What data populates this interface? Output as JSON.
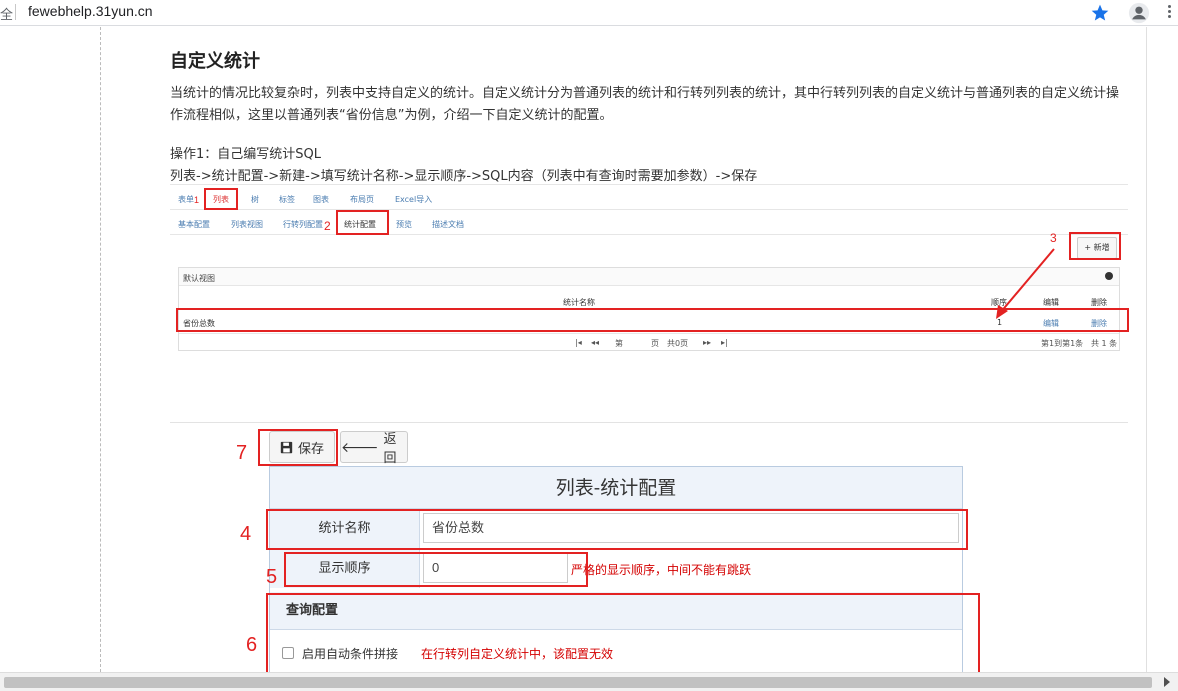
{
  "browser": {
    "secure_label": "全",
    "url": "fewebhelp.31yun.cn"
  },
  "doc": {
    "title": "自定义统计",
    "paragraph": "当统计的情况比较复杂时，列表中支持自定义的统计。自定义统计分为普通列表的统计和行转列列表的统计，其中行转列列表的自定义统计与普通列表的自定义统计操作流程相似，这里以普通列表“省份信息”为例，介绍一下自定义统计的配置。",
    "step1": "操作1：自己编写统计SQL",
    "step2": "列表->统计配置->新建->填写统计名称->显示顺序->SQL内容（列表中有查询时需要加参数）->保存"
  },
  "shot1": {
    "top_tabs": [
      "表单",
      "列表",
      "树",
      "标签",
      "图表",
      "布局页",
      "Excel导入"
    ],
    "sub_tabs": [
      "基本配置",
      "列表视图",
      "行转列配置",
      "统计配置",
      "预览",
      "描述文档"
    ],
    "add_button": "+ 新增",
    "panel_title": "默认视图",
    "columns": [
      "统计名称",
      "顺序",
      "编辑",
      "删除"
    ],
    "row": {
      "name": "省份总数",
      "order": "1",
      "edit": "编辑",
      "delete": "删除"
    },
    "pager": {
      "page_prefix": "第",
      "page_suffix": "页",
      "total_pages": "共0页",
      "range": "第1到第1条",
      "total": "共 1 条"
    },
    "annotations": [
      "1",
      "2",
      "3"
    ]
  },
  "shot2": {
    "save_label": "保存",
    "back_label": "返回",
    "form_title": "列表-统计配置",
    "name_label": "统计名称",
    "name_value": "省份总数",
    "order_label": "显示顺序",
    "order_value": "0",
    "order_hint": "严格的显示顺序，中间不能有跳跃",
    "query_title": "查询配置",
    "auto_cond_label": "启用自动条件拼接",
    "auto_cond_hint": "在行转列自定义统计中，该配置无效",
    "annotations": [
      "4",
      "5",
      "6",
      "7"
    ]
  },
  "colors": {
    "annotation_red": "#e32222",
    "hint_red": "#d40000",
    "link_blue": "#4a7cb0",
    "form_header": "#eef3fa"
  }
}
